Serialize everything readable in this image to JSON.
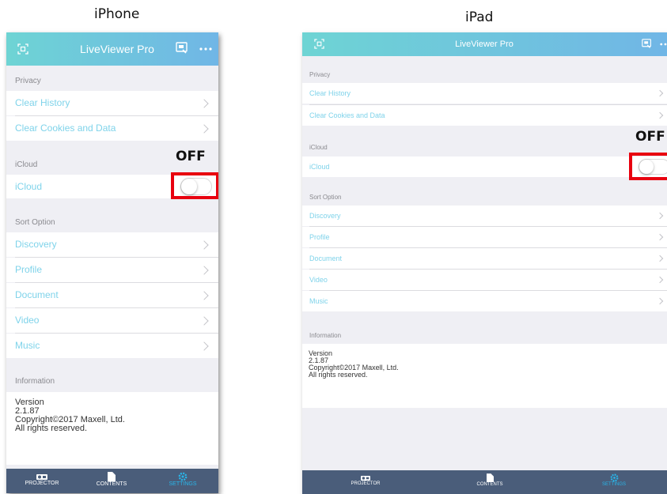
{
  "captions": {
    "left": "iPhone",
    "right": "iPad"
  },
  "app": {
    "title": "LiveViewer Pro"
  },
  "colors": {
    "nav_gradient_start": "#6ed4d4",
    "nav_gradient_end": "#70b6e6",
    "row_text": "#7fd3ea",
    "tabbar": "#4a5d7a",
    "tab_active": "#29b6ea",
    "highlight": "#e8000f"
  },
  "icons": {
    "nav_left": "scan-qr-icon",
    "nav_right": "screen-mirror-icon",
    "nav_more": "more-icon"
  },
  "sections": {
    "privacy": "Privacy",
    "icloud": "iCloud",
    "sort": "Sort Option",
    "info": "Information"
  },
  "privacy_items": [
    "Clear History",
    "Clear Cookies and Data"
  ],
  "icloud_item": {
    "label": "iCloud",
    "toggle": "OFF"
  },
  "sort_items": [
    "Discovery",
    "Profile",
    "Document",
    "Video",
    "Music"
  ],
  "info": {
    "version_label": "Version",
    "version": "2.1.87",
    "copyright": "Copyright©2017 Maxell, Ltd.",
    "rights": "All rights reserved."
  },
  "annotation": {
    "off": "OFF"
  },
  "tabs": [
    "PROJECTOR",
    "CONTENTS",
    "SETTINGS"
  ]
}
